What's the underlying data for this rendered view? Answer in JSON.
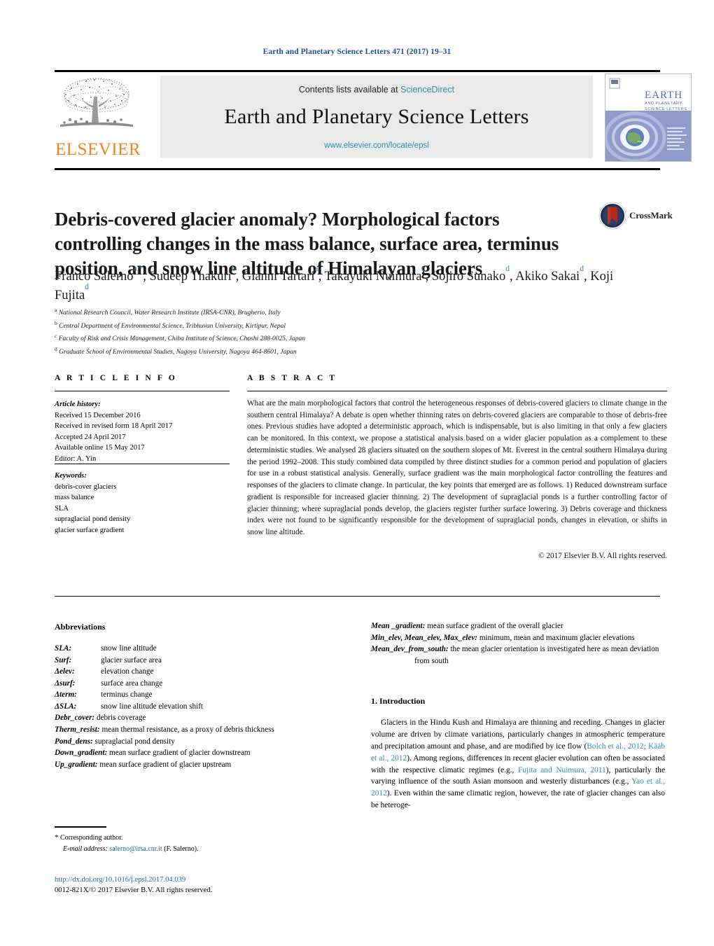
{
  "running_head": "Earth and Planetary Science Letters 471 (2017) 19–31",
  "masthead": {
    "publisher_logo_label": "ELSEVIER",
    "contents_prefix": "Contents lists available at ",
    "contents_link": "ScienceDirect",
    "journal_title": "Earth and Planetary Science Letters",
    "journal_url": "www.elsevier.com/locate/epsl",
    "cover_title_line1": "EARTH",
    "cover_title_line2": "AND PLANETARY",
    "cover_title_line3": "SCIENCE LETTERS"
  },
  "article": {
    "title": "Debris-covered glacier anomaly? Morphological factors controlling changes in the mass balance, surface area, terminus position, and snow line altitude of Himalayan glaciers",
    "crossmark_label": "CrossMark",
    "authors": [
      {
        "name": "Franco Salerno",
        "sup": "a,*",
        "sep": ", "
      },
      {
        "name": "Sudeep Thakuri",
        "sup": "b",
        "sep": ", "
      },
      {
        "name": "Gianni Tartari",
        "sup": "a",
        "sep": ", "
      },
      {
        "name": "Takayuki Nuimura",
        "sup": "c",
        "sep": ", "
      },
      {
        "name": "Sojiro Sunako",
        "sup": "d",
        "sep": ", "
      },
      {
        "name": "Akiko Sakai",
        "sup": "d",
        "sep": ", "
      },
      {
        "name": "Koji Fujita",
        "sup": "d",
        "sep": ""
      }
    ],
    "affiliations": [
      {
        "mark": "a",
        "text": "National Research Council, Water Research Institute (IRSA-CNR), Brugherio, Italy"
      },
      {
        "mark": "b",
        "text": "Central Department of Environmental Science, Tribhuvan University, Kirtipur, Nepal"
      },
      {
        "mark": "c",
        "text": "Faculty of Risk and Crisis Management, Chiba Institute of Science, Choshi 288-0025, Japan"
      },
      {
        "mark": "d",
        "text": "Graduate School of Environmental Studies, Nagoya University, Nagoya 464-8601, Japan"
      }
    ]
  },
  "article_info": {
    "heading": "A R T I C L E   I N F O",
    "history_label": "Article history:",
    "history": [
      "Received 15 December 2016",
      "Received in revised form 18 April 2017",
      "Accepted 24 April 2017",
      "Available online 15 May 2017",
      "Editor: A. Yin"
    ],
    "keywords_label": "Keywords:",
    "keywords": [
      "debris-cover glaciers",
      "mass balance",
      "SLA",
      "supraglacial pond density",
      "glacier surface gradient"
    ]
  },
  "abstract": {
    "heading": "A B S T R A C T",
    "body": "What are the main morphological factors that control the heterogeneous responses of debris-covered glaciers to climate change in the southern central Himalaya? A debate is open whether thinning rates on debris-covered glaciers are comparable to those of debris-free ones. Previous studies have adopted a deterministic approach, which is indispensable, but is also limiting in that only a few glaciers can be monitored. In this context, we propose a statistical analysis based on a wider glacier population as a complement to these deterministic studies. We analysed 28 glaciers situated on the southern slopes of Mt. Everest in the central southern Himalaya during the period 1992–2008. This study combined data compiled by three distinct studies for a common period and population of glaciers for use in a robust statistical analysis. Generally, surface gradient was the main morphological factor controlling the features and responses of the glaciers to climate change. In particular, the key points that emerged are as follows. 1) Reduced downstream surface gradient is responsible for increased glacier thinning. 2) The development of supraglacial ponds is a further controlling factor of glacier thinning; where supraglacial ponds develop, the glaciers register further surface lowering. 3) Debris coverage and thickness index were not found to be significantly responsible for the development of supraglacial ponds, changes in elevation, or shifts in snow line altitude.",
    "copyright": "© 2017 Elsevier B.V. All rights reserved."
  },
  "abbreviations": {
    "heading": "Abbreviations",
    "left_items": [
      {
        "term": "SLA:",
        "def": "snow line altitude"
      },
      {
        "term": "Surf:",
        "def": "glacier surface area"
      },
      {
        "term": "Δelev:",
        "def": "elevation change"
      },
      {
        "term": "Δsurf:",
        "def": "surface area change"
      },
      {
        "term": "Δterm:",
        "def": "terminus change"
      },
      {
        "term": "ΔSLA:",
        "def": "snow line altitude elevation shift"
      },
      {
        "term": "Debr_cover:",
        "def": "debris coverage"
      },
      {
        "term": "Therm_resist:",
        "def": "mean thermal resistance, as a proxy of debris thickness"
      },
      {
        "term": "Pond_dens:",
        "def": "supraglacial pond density"
      },
      {
        "term": "Down_gradient:",
        "def": "mean surface gradient of glacier downstream"
      },
      {
        "term": "Up_gradient:",
        "def": "mean surface gradient of glacier upstream"
      }
    ],
    "right_items": [
      {
        "term": "Mean _gradient:",
        "def": "mean surface gradient of the overall glacier"
      },
      {
        "term": "Min_elev, Mean_elev, Max_elev:",
        "def": "minimum, mean and maximum glacier elevations"
      },
      {
        "term": "Mean_dev_from_south:",
        "def": "the mean glacier orientation is investigated here as mean deviation from south"
      }
    ]
  },
  "introduction": {
    "heading": "1. Introduction",
    "paragraph_parts": [
      {
        "t": "Glaciers in the Hindu Kush and Himalaya are thinning and receding. Changes in glacier volume are driven by climate variations, particularly changes in atmospheric temperature and precipitation amount and phase, and are modified by ice flow (",
        "link": false
      },
      {
        "t": "Bolch et al., 2012; Kääb et al., 2012",
        "link": true
      },
      {
        "t": "). Among regions, differences in recent glacier evolution can often be associated with the respective climatic regimes (e.g., ",
        "link": false
      },
      {
        "t": "Fujita and Nuimura, 2011",
        "link": true
      },
      {
        "t": "), particularly the varying influence of the south Asian monsoon and westerly disturbances (e.g., ",
        "link": false
      },
      {
        "t": "Yao et al., 2012",
        "link": true
      },
      {
        "t": "). Even within the same climatic region, however, the rate of glacier changes can also be heteroge-",
        "link": false
      }
    ]
  },
  "footnote": {
    "star": "*",
    "corresponding": "Corresponding author.",
    "email_label": "E-mail address:",
    "email": "salerno@irsa.cnr.it",
    "email_suffix": "(F. Salerno)."
  },
  "imprint": {
    "doi": "http://dx.doi.org/10.1016/j.epsl.2017.04.039",
    "issn_line": "0012-821X/© 2017 Elsevier B.V. All rights reserved."
  },
  "colors": {
    "link_blue": "#2e8bc0",
    "runhead_blue": "#1f4e96",
    "elsevier_orange": "#f58220",
    "band_grey": "#eaeaea"
  }
}
